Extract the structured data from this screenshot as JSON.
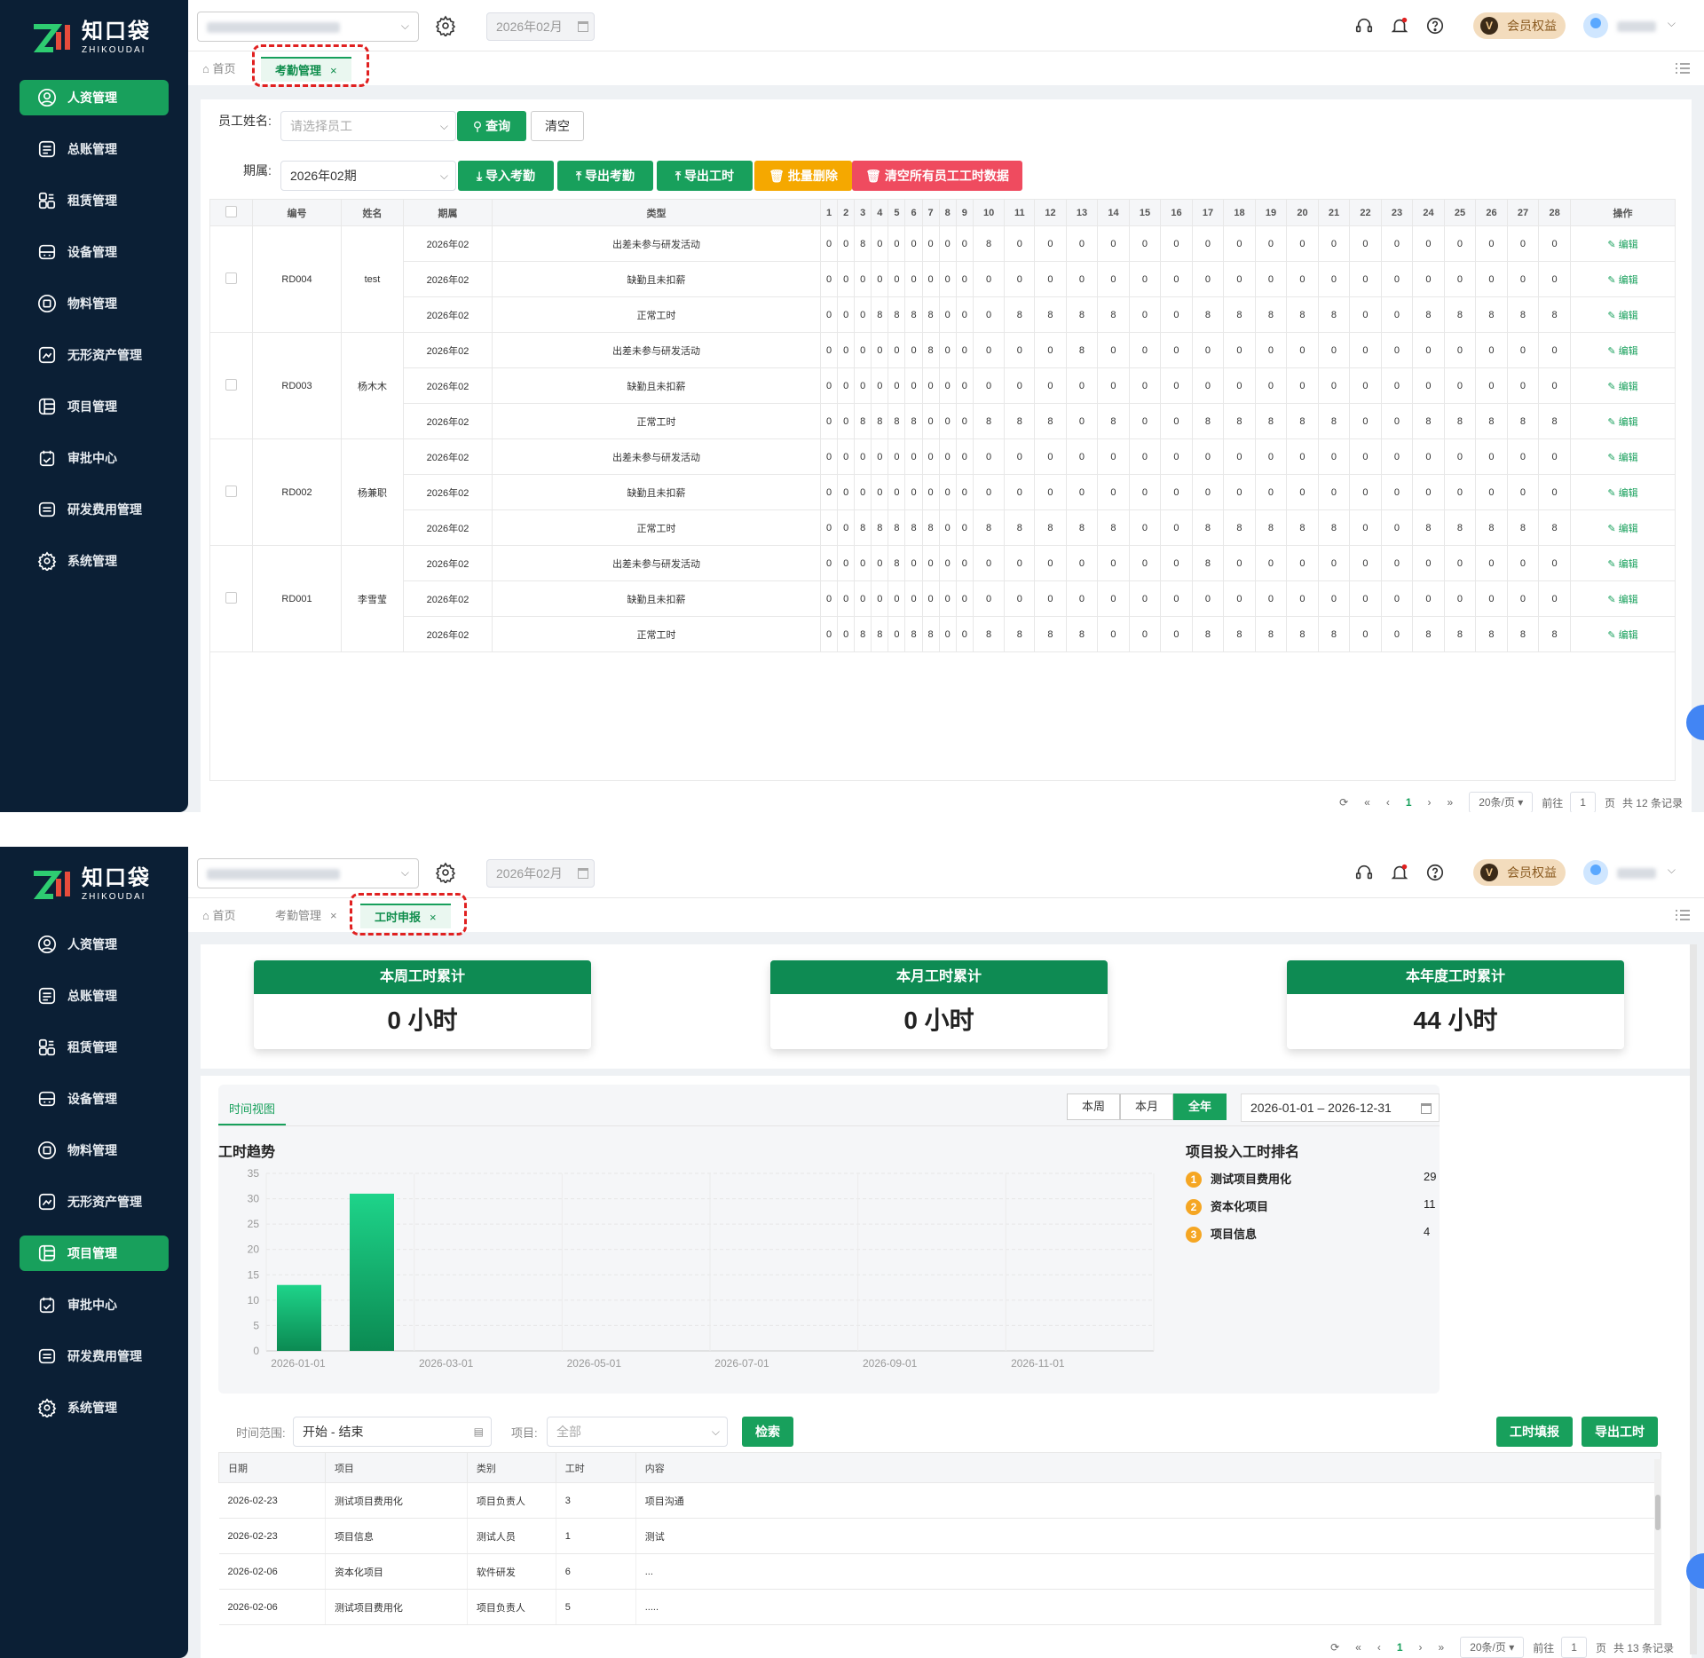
{
  "brand": {
    "cn": "知口袋",
    "en": "ZHIKOUDAI"
  },
  "colors": {
    "primary": "#18a05c",
    "sidebar": "#0b1f35",
    "warning": "#f5a800",
    "danger": "#ef4b5f"
  },
  "menu": [
    "人资管理",
    "总账管理",
    "租赁管理",
    "设备管理",
    "物料管理",
    "无形资产管理",
    "项目管理",
    "审批中心",
    "研发费用管理",
    "系统管理"
  ],
  "topbar": {
    "period": "2026年02月",
    "vip": "会员权益",
    "vip_mark": "V"
  },
  "panel1": {
    "tabs": {
      "home": "首页",
      "active": "考勤管理"
    },
    "filters": {
      "employee_label": "员工姓名:",
      "employee_placeholder": "请选择员工",
      "query": "查询",
      "clear": "清空",
      "period_label": "期属:",
      "period_value": "2026年02期"
    },
    "actions": {
      "import": "导入考勤",
      "export_att": "导出考勤",
      "export_hours": "导出工时",
      "batch_delete": "批量删除",
      "clear_all": "清空所有员工工时数据"
    },
    "columns": {
      "code": "编号",
      "name": "姓名",
      "period": "期属",
      "type": "类型",
      "op": "操作"
    },
    "days": [
      "1",
      "2",
      "3",
      "4",
      "5",
      "6",
      "7",
      "8",
      "9",
      "10",
      "11",
      "12",
      "13",
      "14",
      "15",
      "16",
      "17",
      "18",
      "19",
      "20",
      "21",
      "22",
      "23",
      "24",
      "25",
      "26",
      "27",
      "28"
    ],
    "edit": "编辑",
    "groups": [
      {
        "code": "RD004",
        "name": "test",
        "rows": [
          {
            "period": "2026年02",
            "type": "出差未参与研发活动",
            "v": "0,0,8,0,0,0,0,0,0,8,0,0,0,0,0,0,0,0,0,0,0,0,0,0,0,0,0,0"
          },
          {
            "period": "2026年02",
            "type": "缺勤且未扣薪",
            "v": "0,0,0,0,0,0,0,0,0,0,0,0,0,0,0,0,0,0,0,0,0,0,0,0,0,0,0,0"
          },
          {
            "period": "2026年02",
            "type": "正常工时",
            "v": "0,0,0,8,8,8,8,0,0,0,8,8,8,8,0,0,8,8,8,8,8,0,0,8,8,8,8,8"
          }
        ]
      },
      {
        "code": "RD003",
        "name": "杨木木",
        "rows": [
          {
            "period": "2026年02",
            "type": "出差未参与研发活动",
            "v": "0,0,0,0,0,0,8,0,0,0,0,0,8,0,0,0,0,0,0,0,0,0,0,0,0,0,0,0"
          },
          {
            "period": "2026年02",
            "type": "缺勤且未扣薪",
            "v": "0,0,0,0,0,0,0,0,0,0,0,0,0,0,0,0,0,0,0,0,0,0,0,0,0,0,0,0"
          },
          {
            "period": "2026年02",
            "type": "正常工时",
            "v": "0,0,8,8,8,8,0,0,0,8,8,8,0,8,0,0,8,8,8,8,8,0,0,8,8,8,8,8"
          }
        ]
      },
      {
        "code": "RD002",
        "name": "杨兼职",
        "rows": [
          {
            "period": "2026年02",
            "type": "出差未参与研发活动",
            "v": "0,0,0,0,0,0,0,0,0,0,0,0,0,0,0,0,0,0,0,0,0,0,0,0,0,0,0,0"
          },
          {
            "period": "2026年02",
            "type": "缺勤且未扣薪",
            "v": "0,0,0,0,0,0,0,0,0,0,0,0,0,0,0,0,0,0,0,0,0,0,0,0,0,0,0,0"
          },
          {
            "period": "2026年02",
            "type": "正常工时",
            "v": "0,0,8,8,8,8,8,0,0,8,8,8,8,8,0,0,8,8,8,8,8,0,0,8,8,8,8,8"
          }
        ]
      },
      {
        "code": "RD001",
        "name": "李雪莹",
        "rows": [
          {
            "period": "2026年02",
            "type": "出差未参与研发活动",
            "v": "0,0,0,0,8,0,0,0,0,0,0,0,0,0,0,0,8,0,0,0,0,0,0,0,0,0,0,0"
          },
          {
            "period": "2026年02",
            "type": "缺勤且未扣薪",
            "v": "0,0,0,0,0,0,0,0,0,0,0,0,0,0,0,0,0,0,0,0,0,0,0,0,0,0,0,0"
          },
          {
            "period": "2026年02",
            "type": "正常工时",
            "v": "0,0,8,8,0,8,8,0,0,8,8,8,8,0,0,0,8,8,8,8,8,0,0,8,8,8,8,8"
          }
        ]
      }
    ],
    "pager": {
      "size": "20条/页",
      "goto": "前往",
      "page": "1",
      "page_unit": "页",
      "total": "共 12 条记录"
    }
  },
  "panel2": {
    "tabs": {
      "home": "首页",
      "t2": "考勤管理",
      "active": "工时申报"
    },
    "cards": [
      {
        "title": "本周工时累计",
        "value": "0 小时"
      },
      {
        "title": "本月工时累计",
        "value": "0 小时"
      },
      {
        "title": "本年度工时累计",
        "value": "44 小时"
      }
    ],
    "view_tab": "时间视图",
    "seg": [
      "本周",
      "本月",
      "全年"
    ],
    "range": "2026-01-01 – 2026-12-31",
    "chart_title": "工时趋势",
    "chart_data": {
      "type": "bar",
      "x": [
        "2026-01",
        "2026-02"
      ],
      "values": [
        13,
        31
      ],
      "ylim": [
        0,
        35
      ],
      "yticks": [
        "0",
        "5",
        "10",
        "15",
        "20",
        "25",
        "30",
        "35"
      ],
      "xticks": [
        "2026-01-01",
        "2026-03-01",
        "2026-05-01",
        "2026-07-01",
        "2026-09-01",
        "2026-11-01"
      ],
      "title": "工时趋势",
      "grid": true
    },
    "rank_title": "项目投入工时排名",
    "rank": [
      {
        "no": "1",
        "name": "测试项目费用化",
        "v": "29"
      },
      {
        "no": "2",
        "name": "资本化项目",
        "v": "11"
      },
      {
        "no": "3",
        "name": "项目信息",
        "v": "4"
      }
    ],
    "filters": {
      "range_label": "时间范围:",
      "range_ph": "开始 - 结束",
      "proj_label": "项目:",
      "proj_ph": "全部",
      "search": "检索",
      "report": "工时填报",
      "export": "导出工时"
    },
    "columns": [
      "日期",
      "项目",
      "类别",
      "工时",
      "内容"
    ],
    "rows": [
      [
        "2026-02-23",
        "测试项目费用化",
        "项目负责人",
        "3",
        "项目沟通"
      ],
      [
        "2026-02-23",
        "项目信息",
        "测试人员",
        "1",
        "测试"
      ],
      [
        "2026-02-06",
        "资本化项目",
        "软件研发",
        "6",
        "..."
      ],
      [
        "2026-02-06",
        "测试项目费用化",
        "项目负责人",
        "5",
        "....."
      ]
    ],
    "pager": {
      "size": "20条/页",
      "goto": "前往",
      "page": "1",
      "page_unit": "页",
      "total": "共 13 条记录"
    }
  }
}
